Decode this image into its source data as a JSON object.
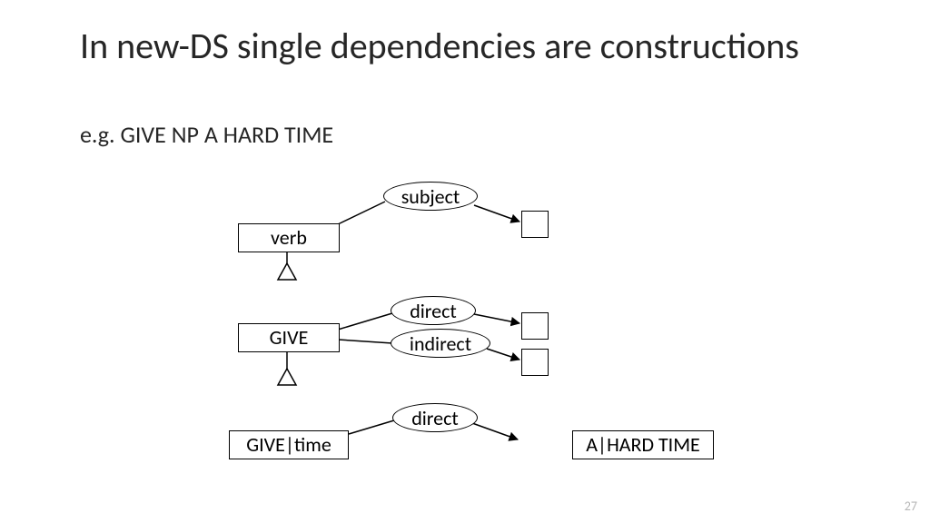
{
  "title": "In new-DS single dependencies are constructions",
  "subtitle": "e.g. GIVE NP A HARD TIME",
  "page_number": "27",
  "diagram": {
    "nodes": {
      "verb": "verb",
      "give": "GIVE",
      "givetime": "GIVE|time",
      "ahardtime": "A|HARD TIME"
    },
    "edges": {
      "subject": "subject",
      "direct1": "direct",
      "indirect": "indirect",
      "direct2": "direct"
    }
  }
}
